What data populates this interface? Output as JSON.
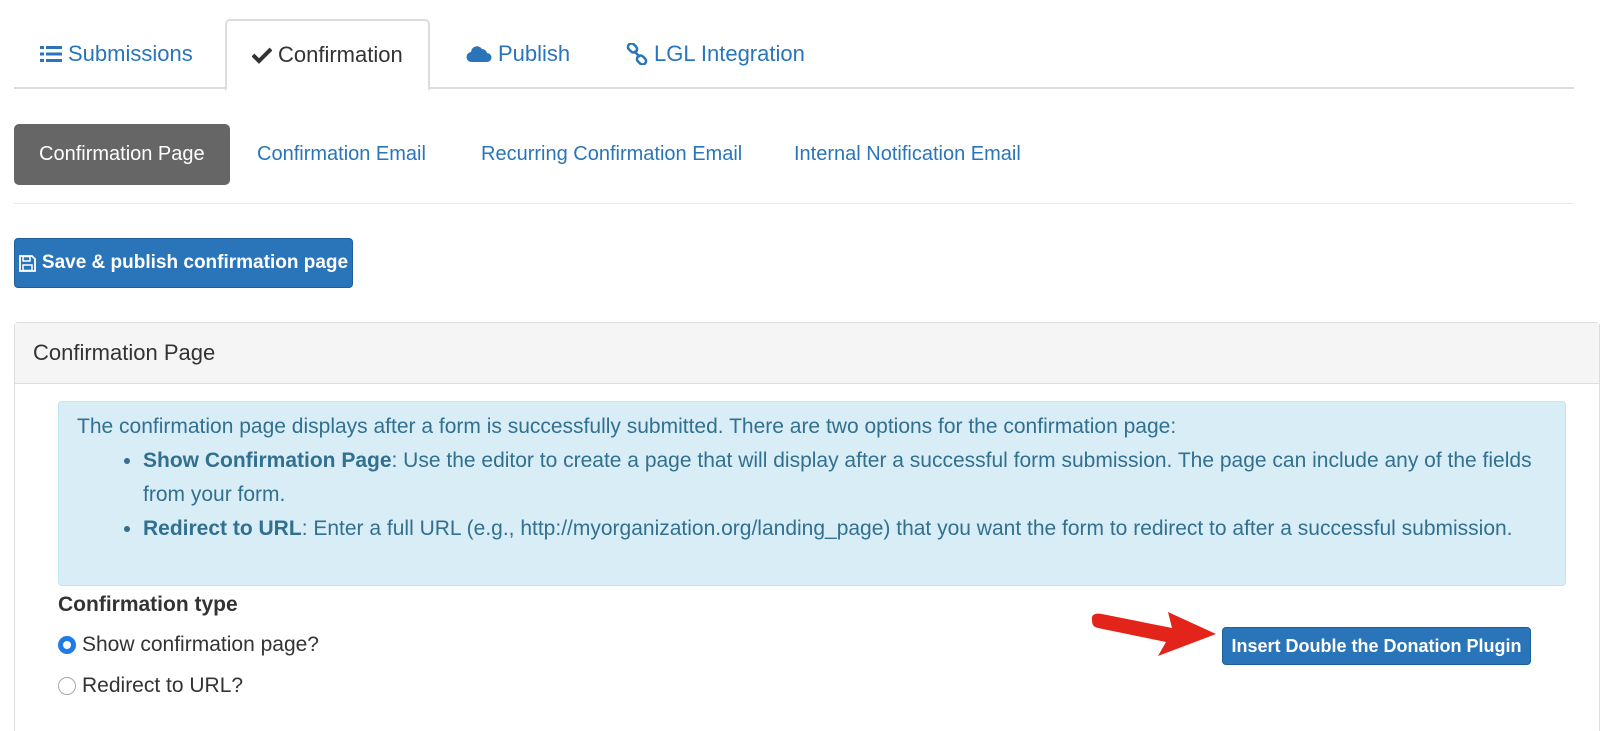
{
  "top_tabs": [
    {
      "label": "Submissions",
      "icon": "list-icon"
    },
    {
      "label": "Confirmation",
      "icon": "check-icon",
      "active": true
    },
    {
      "label": "Publish",
      "icon": "cloud-icon"
    },
    {
      "label": "LGL Integration",
      "icon": "link-icon"
    }
  ],
  "sub_tabs": [
    {
      "label": "Confirmation Page",
      "active": true
    },
    {
      "label": "Confirmation Email"
    },
    {
      "label": "Recurring Confirmation Email"
    },
    {
      "label": "Internal Notification Email"
    }
  ],
  "save_button": {
    "label": "Save & publish confirmation page",
    "icon": "floppy-disk-icon"
  },
  "panel": {
    "title": "Confirmation Page",
    "info": {
      "intro": "The confirmation page displays after a form is successfully submitted. There are two options for the confirmation page:",
      "items": [
        {
          "term": "Show Confirmation Page",
          "text": ": Use the editor to create a page that will display after a successful form submission. The page can include any of the fields from your form."
        },
        {
          "term": "Redirect to URL",
          "text": ": Enter a full URL (e.g., http://myorganization.org/landing_page) that you want the form to redirect to after a successful submission."
        }
      ]
    },
    "confirmation_type_label": "Confirmation type",
    "options": [
      {
        "label": "Show confirmation page?",
        "checked": true
      },
      {
        "label": "Redirect to URL?",
        "checked": false
      }
    ],
    "insert_button": "Insert Double the Donation Plugin"
  },
  "colors": {
    "link": "#2a75b9",
    "button": "#2a75b9",
    "active_subtab": "#666666",
    "alert_bg": "#d9edf7",
    "alert_text": "#31708f",
    "arrow": "#e3241b"
  }
}
